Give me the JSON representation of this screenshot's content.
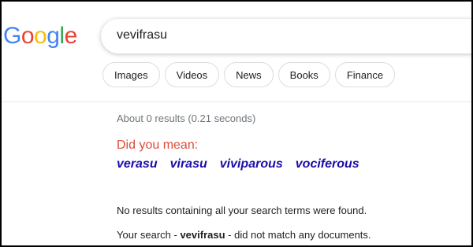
{
  "logo": {
    "letters": [
      "G",
      "o",
      "o",
      "g",
      "l",
      "e"
    ],
    "colors": [
      "#4285F4",
      "#EA4335",
      "#FBBC05",
      "#4285F4",
      "#34A853",
      "#EA4335"
    ]
  },
  "search": {
    "query": "vevifrasu"
  },
  "tabs": [
    {
      "label": "Images"
    },
    {
      "label": "Videos"
    },
    {
      "label": "News"
    },
    {
      "label": "Books"
    },
    {
      "label": "Finance"
    }
  ],
  "results": {
    "stats": "About 0 results (0.21 seconds)",
    "did_you_mean_label": "Did you mean:",
    "suggestions": [
      "verasu",
      "virasu",
      "viviparous",
      "vociferous"
    ],
    "no_results_message": "No results containing all your search terms were found.",
    "your_search_prefix": "Your search - ",
    "your_search_term": "vevifrasu",
    "your_search_suffix": " - did not match any documents."
  },
  "colors": {
    "did_you_mean": "#dd4b39",
    "suggestion_link": "#1a0dab",
    "muted_text": "#70757a"
  }
}
